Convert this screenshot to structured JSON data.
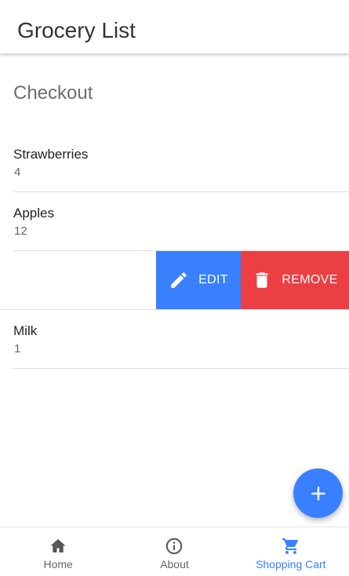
{
  "header": {
    "title": "Grocery List"
  },
  "section": {
    "title": "Checkout"
  },
  "items": [
    {
      "name": "Strawberries",
      "qty": "4"
    },
    {
      "name": "Apples",
      "qty": "12"
    },
    {
      "name": "",
      "qty": ""
    },
    {
      "name": "Milk",
      "qty": "1"
    }
  ],
  "swipe_actions": {
    "edit_label": "EDIT",
    "remove_label": "REMOVE"
  },
  "fab": {
    "icon": "plus-icon"
  },
  "tabs": [
    {
      "label": "Home",
      "icon": "home-icon"
    },
    {
      "label": "About",
      "icon": "info-icon"
    },
    {
      "label": "Shopping Cart",
      "icon": "cart-icon",
      "active": true
    }
  ],
  "colors": {
    "primary": "#3880ff",
    "danger": "#eb3f44",
    "text": "#222222",
    "muted": "#666666"
  }
}
